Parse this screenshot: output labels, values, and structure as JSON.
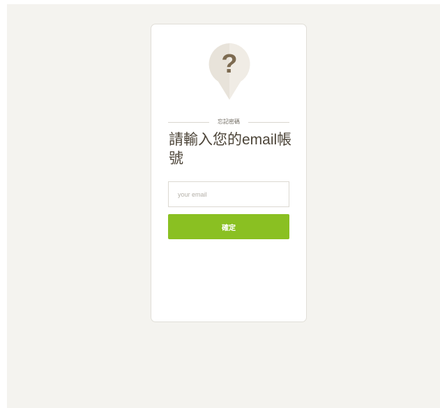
{
  "forgot_password": {
    "icon": "question-mark-bubble-icon",
    "section_label": "忘記密碼",
    "title": "請輸入您的email帳號",
    "email_placeholder": "your email",
    "email_value": "",
    "submit_label": "確定"
  },
  "colors": {
    "page_background": "#f4f3ef",
    "card_background": "#ffffff",
    "title_text": "#4c4438",
    "icon_bubble": "#e8e3da",
    "icon_glyph": "#7d6b51",
    "submit_button": "#8ac022"
  }
}
